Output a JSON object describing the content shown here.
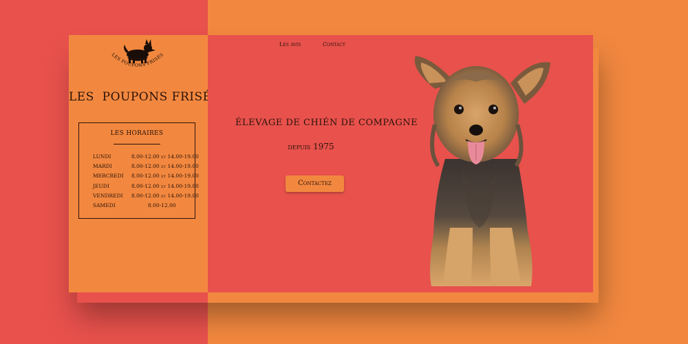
{
  "brand": {
    "name": "LES  POUPONS FRISÉS",
    "logo_text": "LES POUPONS FRISÉS"
  },
  "nav": {
    "avis": "Les avis",
    "contact": "Contact"
  },
  "hero": {
    "headline": "ÉLEVAGE DE CHIÉN DE COMPAGNE",
    "since": "depuis 1975",
    "cta": "Contactez"
  },
  "hours": {
    "title": "LES HORAIRES",
    "rows": [
      {
        "day": "LUNDI",
        "time": "8.00-12.00 et 14.00-19.00"
      },
      {
        "day": "MARDI",
        "time": "8.00-12.00 et 14.00-19.00"
      },
      {
        "day": "MERCREDI",
        "time": "8.00-12.00 et 14.00-19.00"
      },
      {
        "day": "JEUDI",
        "time": "8.00-12.00 et 14.00-19.00"
      },
      {
        "day": "VENDREDI",
        "time": "8.00-12.00 et 14.00-19.00"
      },
      {
        "day": "SAMEDI",
        "time": "8.00-12.00"
      }
    ]
  },
  "colors": {
    "orange": "#f2883f",
    "coral": "#e8514c",
    "text": "#2a120a"
  },
  "icons": {
    "logo": "dog-silhouette-icon",
    "hero": "yorkshire-terrier-image"
  }
}
